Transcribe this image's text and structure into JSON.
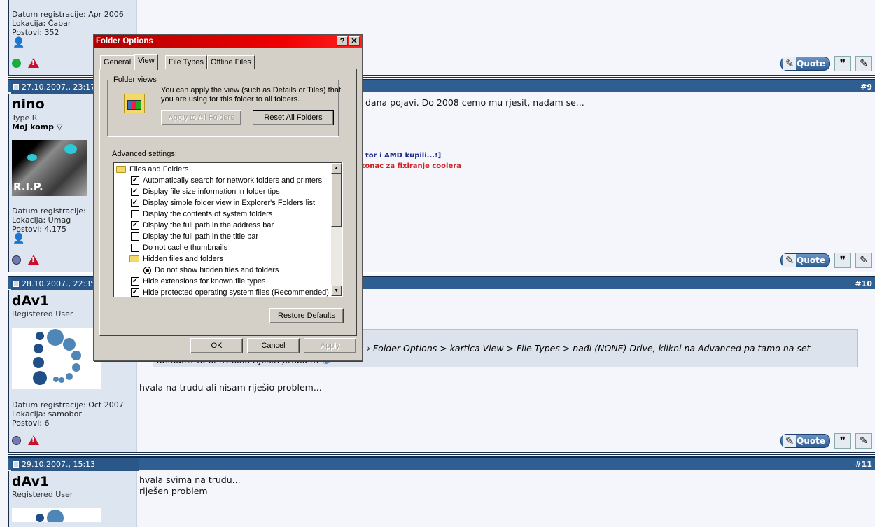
{
  "posts": [
    {
      "info": [
        "Datum registracije: Apr 2006",
        "Lokacija: Čabar",
        "Postovi: 352"
      ]
    },
    {
      "date": "27.10.2007., 23:17",
      "number": "#9",
      "user": "nino",
      "title": "Type R",
      "extra": "Moj komp",
      "info": [
        "Datum registracije:",
        "Lokacija: Umag",
        "Postovi: 4,175"
      ],
      "message": "dana pojavi. Do 2008 cemo mu rjesit, nadam se...",
      "sig1": "tor i AMD kupili...!]",
      "sig2": "konac za fixiranje coolera"
    },
    {
      "date": "28.10.2007., 22:35",
      "number": "#10",
      "user": "dAv1",
      "title": "Registered User",
      "info": [
        "Datum registracije: Oct 2007",
        "Lokacija: samobor",
        "Postovi: 6"
      ],
      "quote1": "Folder Options > kartica View > File Types > nađi (NONE) Drive, klikni na Advanced pa tamo na set",
      "quote2": "default.. To bi trebalo riješiti problem",
      "message": "hvala na trudu ali nisam riješio problem..."
    },
    {
      "date": "29.10.2007., 15:13",
      "number": "#11",
      "user": "dAv1",
      "title": "Registered User",
      "message1": "hvala svima na trudu...",
      "message2": "riješen problem"
    }
  ],
  "buttons": {
    "quote": "Quote"
  },
  "dialog": {
    "title": "Folder Options",
    "help": "?",
    "close": "✕",
    "tabs": [
      "General",
      "View",
      "File Types",
      "Offline Files"
    ],
    "folder_views_label": "Folder views",
    "folder_views_text": "You can apply the view (such as Details or Tiles) that you are using for this folder to all folders.",
    "apply_all": "Apply to All Folders",
    "reset_all": "Reset All Folders",
    "advanced_label": "Advanced settings:",
    "items": [
      {
        "type": "folder",
        "label": "Files and Folders"
      },
      {
        "type": "check",
        "checked": true,
        "label": "Automatically search for network folders and printers"
      },
      {
        "type": "check",
        "checked": true,
        "label": "Display file size information in folder tips"
      },
      {
        "type": "check",
        "checked": true,
        "label": "Display simple folder view in Explorer's Folders list"
      },
      {
        "type": "check",
        "checked": false,
        "label": "Display the contents of system folders"
      },
      {
        "type": "check",
        "checked": true,
        "label": "Display the full path in the address bar"
      },
      {
        "type": "check",
        "checked": false,
        "label": "Display the full path in the title bar"
      },
      {
        "type": "check",
        "checked": false,
        "label": "Do not cache thumbnails"
      },
      {
        "type": "folder2",
        "label": "Hidden files and folders"
      },
      {
        "type": "radio",
        "label": "Do not show hidden files and folders"
      },
      {
        "type": "check",
        "checked": true,
        "label": "Hide extensions for known file types"
      },
      {
        "type": "check",
        "checked": true,
        "label": "Hide protected operating system files (Recommended)"
      }
    ],
    "restore": "Restore Defaults",
    "ok": "OK",
    "cancel": "Cancel",
    "apply": "Apply"
  }
}
